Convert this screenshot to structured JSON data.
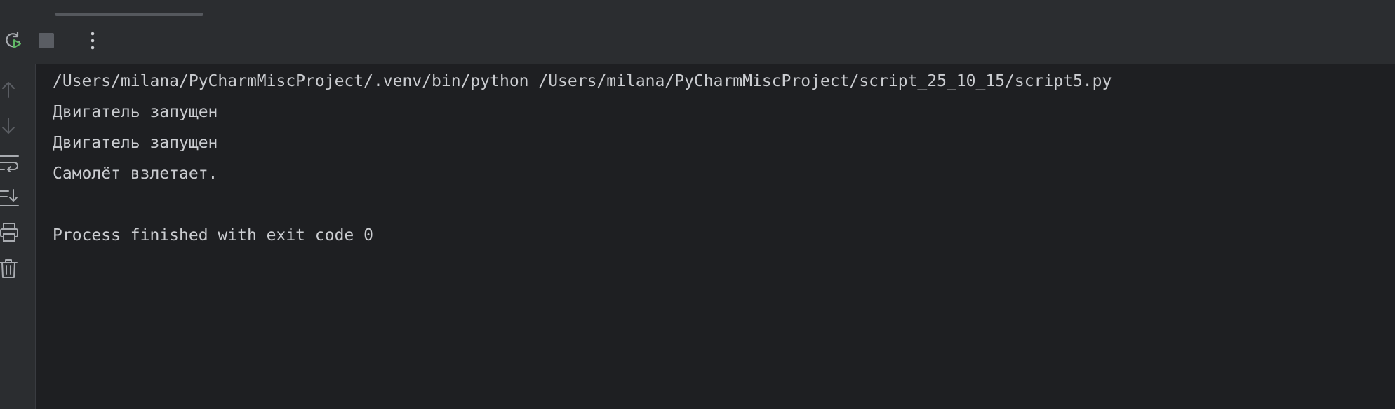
{
  "toolbar": {
    "rerun_icon": "rerun-icon",
    "stop_icon": "stop-icon",
    "more_icon": "more-vertical-icon"
  },
  "gutter": {
    "items": [
      {
        "icon": "arrow-up-icon"
      },
      {
        "icon": "arrow-down-icon"
      },
      {
        "icon": "soft-wrap-icon"
      },
      {
        "icon": "scroll-to-end-icon"
      },
      {
        "icon": "print-icon"
      },
      {
        "icon": "trash-icon"
      }
    ]
  },
  "console": {
    "lines": [
      "/Users/milana/PyCharmMiscProject/.venv/bin/python /Users/milana/PyCharmMiscProject/script_25_10_15/script5.py",
      "Двигатель запущен",
      "Двигатель запущен",
      "Самолёт взлетает.",
      "",
      "Process finished with exit code 0"
    ]
  },
  "colors": {
    "background": "#1e1f22",
    "panel": "#2b2d30",
    "text": "#cbcdd1",
    "icon": "#a8abb0",
    "icon_disabled": "#5a5d63",
    "run_green": "#5fb865"
  }
}
